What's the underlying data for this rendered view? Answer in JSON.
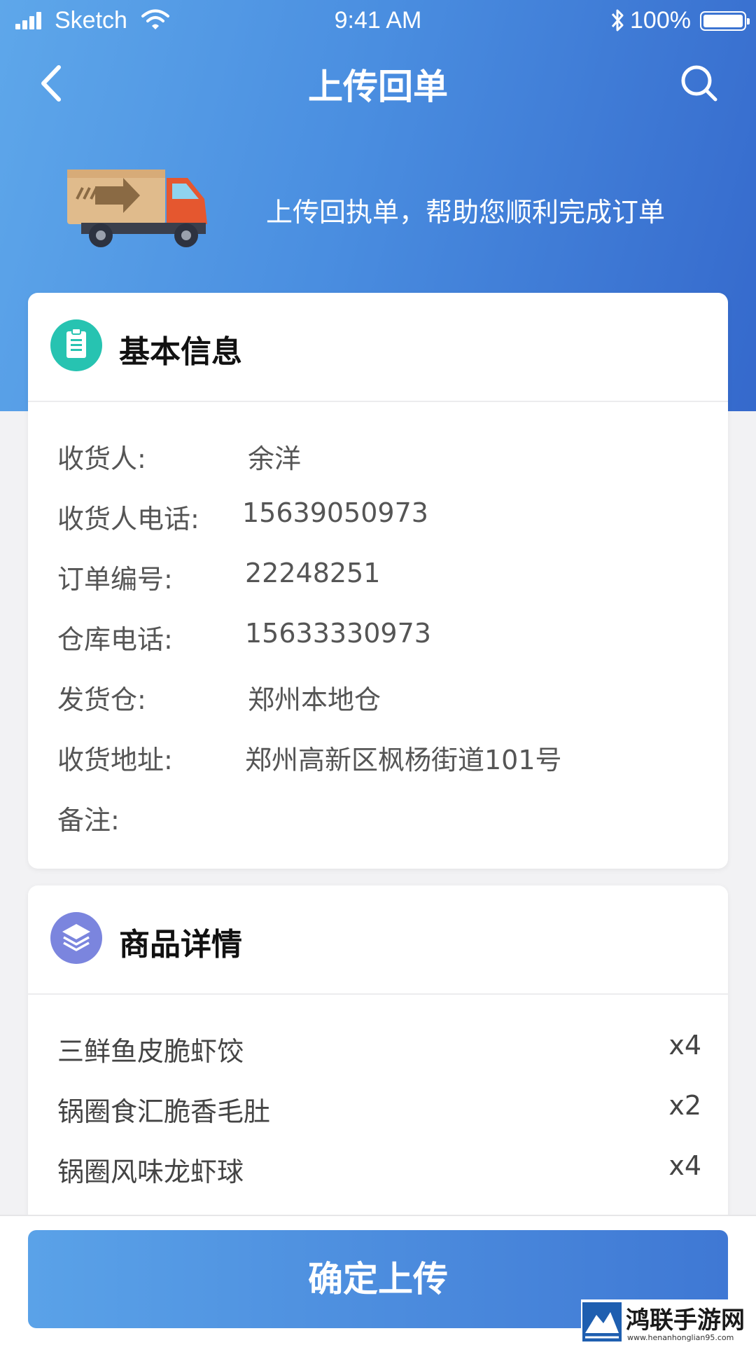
{
  "status_bar": {
    "carrier": "Sketch",
    "time": "9:41 AM",
    "battery": "100%"
  },
  "nav": {
    "title": "上传回单"
  },
  "hero": {
    "slogan": "上传回执单，帮助您顺利完成订单"
  },
  "basic_info": {
    "title": "基本信息",
    "rows": [
      {
        "label": "收货人:",
        "value": "余洋"
      },
      {
        "label": "收货人电话:",
        "value": "15639050973"
      },
      {
        "label": "订单编号:",
        "value": "22248251"
      },
      {
        "label": "仓库电话:",
        "value": "15633330973"
      },
      {
        "label": "发货仓:",
        "value": "郑州本地仓"
      },
      {
        "label": "收货地址:",
        "value": "郑州高新区枫杨街道101号"
      },
      {
        "label": "备注:",
        "value": ""
      }
    ]
  },
  "goods": {
    "title": "商品详情",
    "items": [
      {
        "name": "三鲜鱼皮脆虾饺",
        "qty": "x4"
      },
      {
        "name": "锅圈食汇脆香毛肚",
        "qty": "x2"
      },
      {
        "name": "锅圈风味龙虾球",
        "qty": "x4"
      }
    ]
  },
  "actions": {
    "confirm_label": "确定上传"
  },
  "watermark": {
    "title": "鸿联手游网",
    "url": "www.henanhonglian95.com"
  },
  "colors": {
    "header_gradient_start": "#5ea7ea",
    "header_gradient_end": "#3569cc",
    "basic_icon": "#27c3b1",
    "goods_icon": "#7b85de"
  }
}
